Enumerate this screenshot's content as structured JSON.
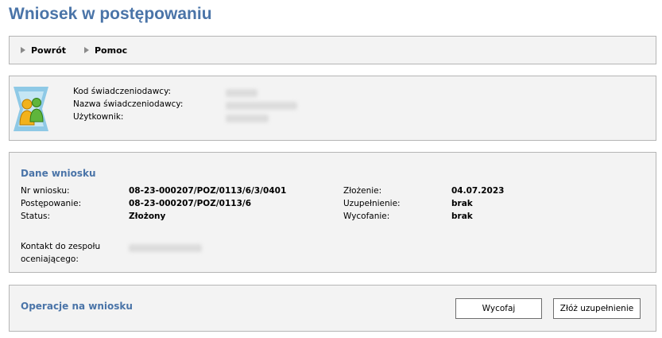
{
  "page": {
    "title": "Wniosek w postępowaniu"
  },
  "toolbar": {
    "back_label": "Powrót",
    "help_label": "Pomoc"
  },
  "provider": {
    "code_label": "Kod świadczeniodawcy:",
    "name_label": "Nazwa świadczeniodawcy:",
    "user_label": "Użytkownik:"
  },
  "application": {
    "section_title": "Dane wniosku",
    "number_label": "Nr wniosku:",
    "number_value": "08-23-000207/POZ/0113/6/3/0401",
    "proceeding_label": "Postępowanie:",
    "proceeding_value": "08-23-000207/POZ/0113/6",
    "status_label": "Status:",
    "status_value": "Złożony",
    "submitted_label": "Złożenie:",
    "submitted_value": "04.07.2023",
    "supplement_label": "Uzupełnienie:",
    "supplement_value": "brak",
    "withdrawal_label": "Wycofanie:",
    "withdrawal_value": "brak",
    "contact_label_line1": "Kontakt do zespołu",
    "contact_label_line2": "oceniającego:"
  },
  "operations": {
    "section_title": "Operacje na wniosku",
    "withdraw_label": "Wycofaj",
    "supplement_label": "Złóż uzupełnienie"
  },
  "colors": {
    "accent": "#4a74a8",
    "panel_bg": "#f3f3f3",
    "border": "#b5b5b5"
  }
}
